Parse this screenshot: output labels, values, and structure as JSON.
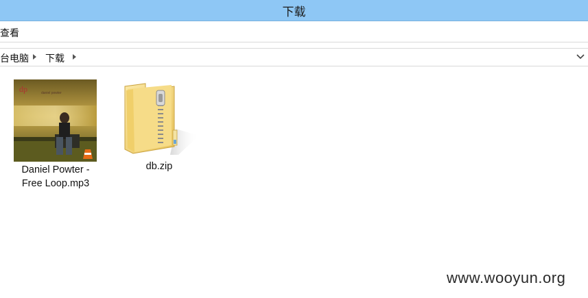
{
  "window": {
    "title": "下载"
  },
  "ribbon": {
    "view_tab": "查看"
  },
  "address": {
    "crumbs": [
      "台电脑",
      "下载"
    ]
  },
  "files": [
    {
      "name_line1": "Daniel Powter -",
      "name_line2": "Free Loop.mp3",
      "thumb_text": "daniel powter",
      "thumb_logo": "dp",
      "icon": "album-art-thumbnail"
    },
    {
      "name": "db.zip",
      "icon": "zip-folder-icon"
    }
  ],
  "watermark": "www.wooyun.org"
}
